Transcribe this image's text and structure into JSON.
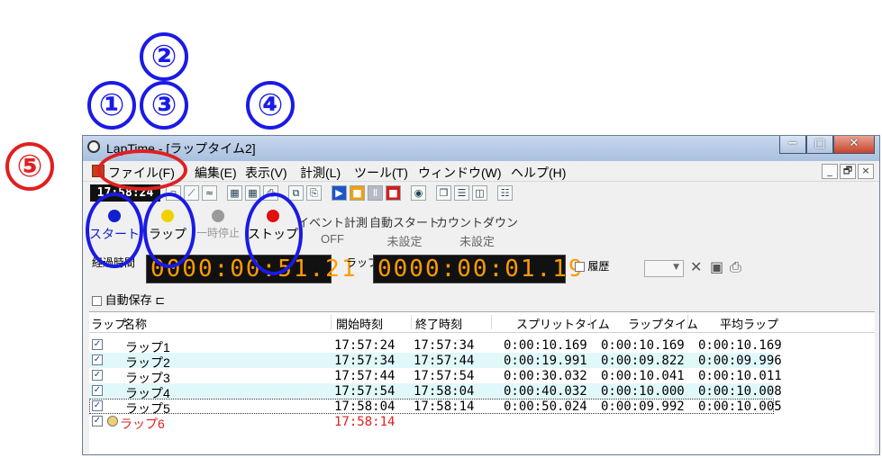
{
  "annotations": {
    "n1": "①",
    "n2": "②",
    "n3": "③",
    "n4": "④",
    "n5": "⑤"
  },
  "window": {
    "title": "LapTime - [ラップタイム2]",
    "minimize": "−",
    "maximize": "□",
    "close": "✕"
  },
  "menu": [
    {
      "label": "ファイル(F)"
    },
    {
      "label": "編集(E)"
    },
    {
      "label": "表示(V)"
    },
    {
      "label": "計測(L)"
    },
    {
      "label": "ツール(T)"
    },
    {
      "label": "ウィンドウ(W)"
    },
    {
      "label": "ヘルプ(H)"
    }
  ],
  "mdi": {
    "min": "_",
    "restore": "🗗",
    "close": "×"
  },
  "toolbar": {
    "clock": "17:58:24"
  },
  "controls": {
    "start": "スタート",
    "lap": "ラップ",
    "pause": "一時停止",
    "stop": "ストップ"
  },
  "status": [
    {
      "label": "イベント計測",
      "value": "OFF"
    },
    {
      "label": "自動スタート",
      "value": "未設定"
    },
    {
      "label": "カウントダウン",
      "value": "未設定"
    }
  ],
  "timers": {
    "elapsed_label": "経過時間",
    "elapsed": "0000:00:51.21",
    "lap_label": "ラップ",
    "lap": "0000:00:01.19",
    "history_label": "履歴"
  },
  "autosave": {
    "label": "自動保存"
  },
  "table": {
    "headers": [
      "ラップ",
      "名称",
      "開始時刻",
      "終了時刻",
      "スプリットタイム",
      "ラップタイム",
      "平均ラップ"
    ],
    "rows": [
      {
        "name": "ラップ1",
        "start": "17:57:24",
        "end": "17:57:34",
        "split": "0:00:10.169",
        "lap": "0:00:10.169",
        "avg": "0:00:10.169"
      },
      {
        "name": "ラップ2",
        "start": "17:57:34",
        "end": "17:57:44",
        "split": "0:00:19.991",
        "lap": "0:00:09.822",
        "avg": "0:00:09.996"
      },
      {
        "name": "ラップ3",
        "start": "17:57:44",
        "end": "17:57:54",
        "split": "0:00:30.032",
        "lap": "0:00:10.041",
        "avg": "0:00:10.011"
      },
      {
        "name": "ラップ4",
        "start": "17:57:54",
        "end": "17:58:04",
        "split": "0:00:40.032",
        "lap": "0:00:10.000",
        "avg": "0:00:10.008"
      },
      {
        "name": "ラップ5",
        "start": "17:58:04",
        "end": "17:58:14",
        "split": "0:00:50.024",
        "lap": "0:00:09.992",
        "avg": "0:00:10.005"
      },
      {
        "name": "ラップ6",
        "start": "17:58:14",
        "end": "",
        "split": "",
        "lap": "",
        "avg": ""
      }
    ]
  },
  "colors": {
    "annotation_blue": "#1a1ae6",
    "annotation_red": "#e02020",
    "lcd_text": "#ff9b00",
    "row_alt": "#e1f8fb",
    "current_row_text": "#e02020"
  }
}
